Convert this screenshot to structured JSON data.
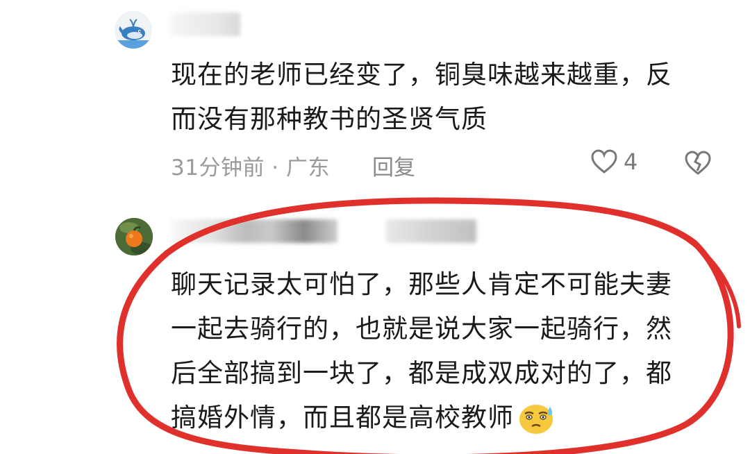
{
  "comments": [
    {
      "body_line1": "现在的老师已经变了，铜臭味越来越重，反",
      "body_line2": "而没有那种教书的圣贤气质",
      "meta": "31分钟前 · 广东",
      "reply_label": "回复",
      "like_count": "4",
      "avatar_icon": "whale-icon"
    },
    {
      "body_line1": "聊天记录太可怕了，那些人肯定不可能夫妻",
      "body_line2": "一起去骑行的，也就是说大家一起骑行，然",
      "body_line3": "后全部搞到一块了，都是成双成对的了，都",
      "body_line4": "搞婚外情，而且都是高校教师",
      "avatar_icon": "orange-fruit-icon",
      "emoji_icon": "sweat-smile-emoji-icon"
    }
  ],
  "colors": {
    "annotation_circle": "#e0302c",
    "text": "#1a1a1a",
    "meta": "#9a9a9a"
  }
}
